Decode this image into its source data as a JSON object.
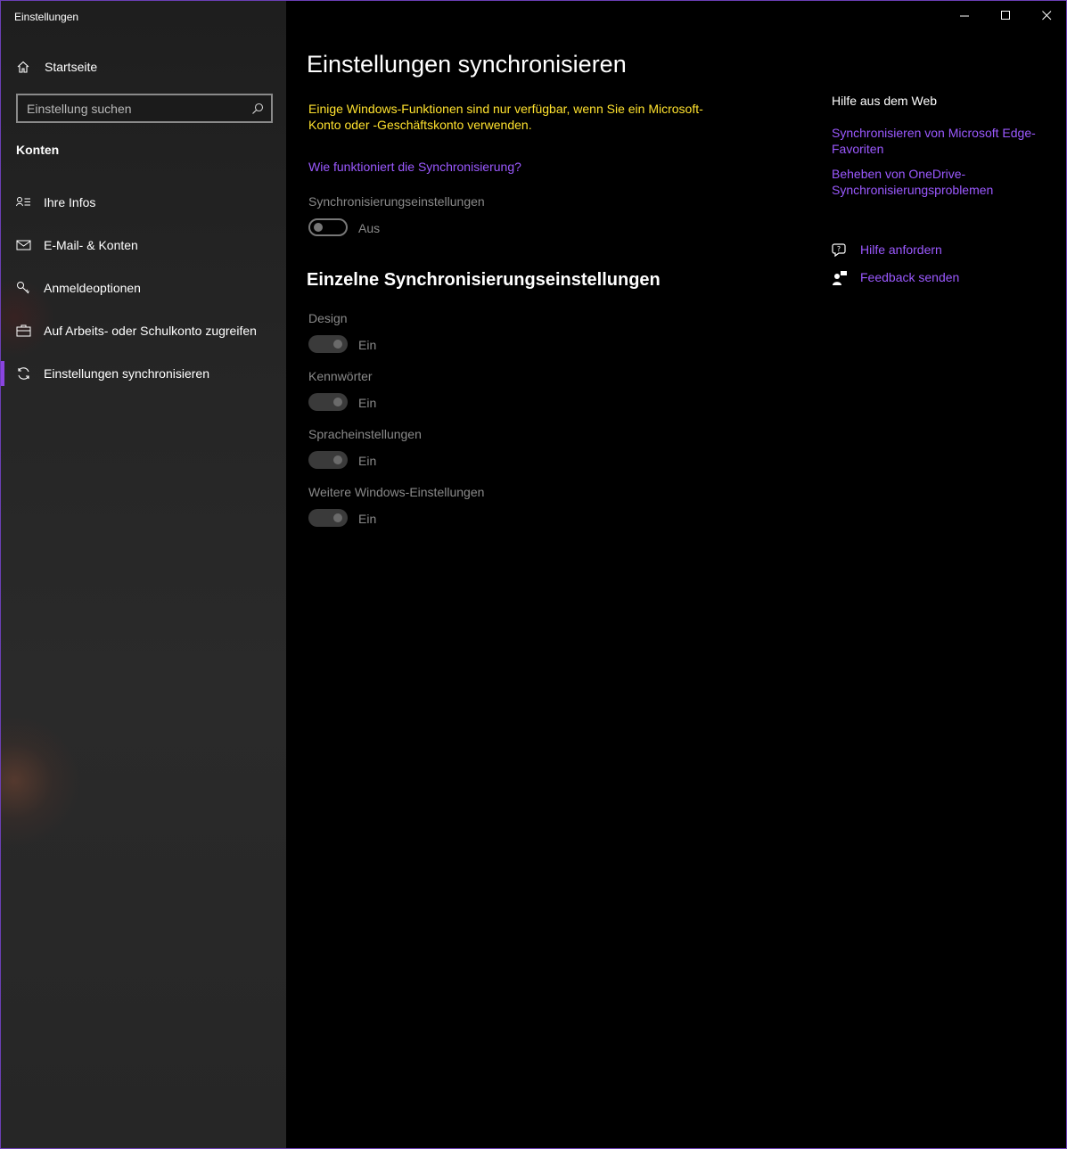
{
  "window": {
    "title": "Einstellungen",
    "controls": [
      "minimize",
      "maximize",
      "close"
    ]
  },
  "sidebar": {
    "home_label": "Startseite",
    "search_placeholder": "Einstellung suchen",
    "section_title": "Konten",
    "items": [
      {
        "label": "Ihre Infos",
        "icon": "person-card-icon"
      },
      {
        "label": "E-Mail- & Konten",
        "icon": "mail-icon"
      },
      {
        "label": "Anmeldeoptionen",
        "icon": "key-icon"
      },
      {
        "label": "Auf Arbeits- oder Schulkonto zugreifen",
        "icon": "briefcase-icon"
      },
      {
        "label": "Einstellungen synchronisieren",
        "icon": "sync-icon",
        "active": true
      }
    ]
  },
  "main": {
    "title": "Einstellungen synchronisieren",
    "warning": "Einige Windows-Funktionen sind nur verfügbar, wenn Sie ein Microsoft-Konto oder -Geschäftskonto verwenden.",
    "how_link": "Wie funktioniert die Synchronisierung?",
    "sync_settings_label": "Synchronisierungseinstellungen",
    "sync_settings_state": "Aus",
    "individual_heading": "Einzelne Synchronisierungseinstellungen",
    "individual": [
      {
        "label": "Design",
        "state": "Ein"
      },
      {
        "label": "Kennwörter",
        "state": "Ein"
      },
      {
        "label": "Spracheinstellungen",
        "state": "Ein"
      },
      {
        "label": "Weitere Windows-Einstellungen",
        "state": "Ein"
      }
    ]
  },
  "help": {
    "title": "Hilfe aus dem Web",
    "links": [
      "Synchronisieren von Microsoft Edge-Favoriten",
      "Beheben von OneDrive-Synchronisierungsproblemen"
    ],
    "get_help": "Hilfe anfordern",
    "feedback": "Feedback senden"
  },
  "colors": {
    "accent": "#8a44e0",
    "link": "#9b59ff",
    "warning": "#ffe22e",
    "background": "#000000"
  }
}
